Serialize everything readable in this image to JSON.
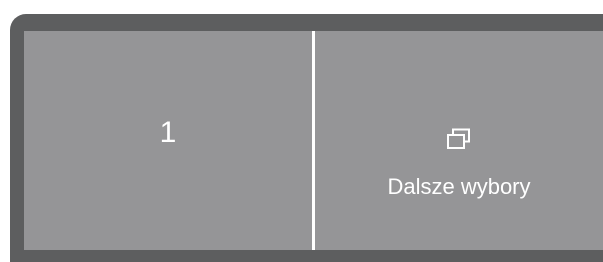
{
  "left_panel": {
    "value": "1"
  },
  "right_panel": {
    "icon": "windows-stack-icon",
    "label": "Dalsze wybory"
  },
  "colors": {
    "frame": "#5d5e5f",
    "panel": "#959597",
    "divider": "#ffffff",
    "text": "#ffffff"
  }
}
